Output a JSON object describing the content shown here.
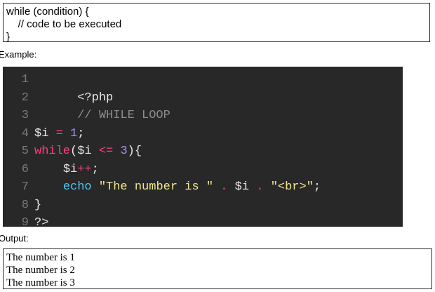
{
  "syntax": {
    "lines": [
      "while (condition) {",
      "    // code to be executed",
      "}"
    ]
  },
  "labels": {
    "example": "Example:",
    "output": "Output:"
  },
  "code_block": {
    "line_numbers": [
      "1",
      "2",
      "3",
      "4",
      "5",
      "6",
      "7",
      "8",
      "9"
    ],
    "line1": {
      "tag": "<?php"
    },
    "line2": {
      "comment": "// WHILE LOOP"
    },
    "line4": {
      "var": "$i ",
      "op": "=",
      "sp": " ",
      "num": "1",
      "semi": ";"
    },
    "line5": {
      "kw": "while",
      "open": "(",
      "var": "$i ",
      "op": "<=",
      "sp": " ",
      "num": "3",
      "close": "){"
    },
    "line6": {
      "indent": "    ",
      "var": "$i",
      "op": "++",
      "semi": ";"
    },
    "line7": {
      "indent": "    ",
      "fn": "echo",
      "sp1": " ",
      "str1": "\"The number is \"",
      "sp2": " ",
      "dot1": ".",
      "sp3": " ",
      "var": "$i",
      "sp4": " ",
      "dot2": ".",
      "sp5": " ",
      "str2": "\"<br>\"",
      "semi": ";"
    },
    "line8": {
      "brace": "}"
    },
    "line9": {
      "tag": "?>"
    }
  },
  "output": {
    "lines": [
      "The number is 1",
      "The number is 2",
      "The number is 3"
    ]
  },
  "colors": {
    "code_background": "#282828",
    "keyword": "#ff3d7f",
    "number": "#b08cff",
    "function": "#4fc3f7",
    "string": "#f0e68c",
    "comment": "#8c8c8c"
  }
}
